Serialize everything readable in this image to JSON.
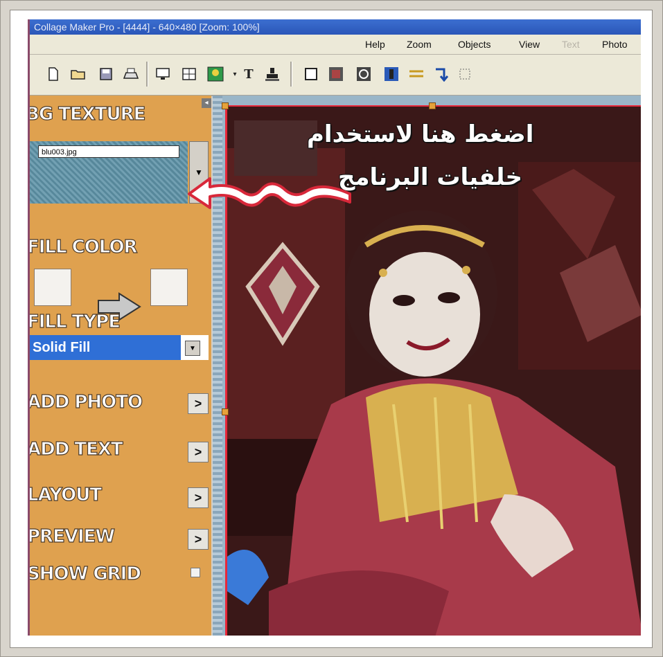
{
  "window": {
    "title": "Collage Maker Pro - [4444] - 640×480 [Zoom: 100%]"
  },
  "menu": {
    "items": [
      "Help",
      "Zoom",
      "Objects",
      "View",
      "Text",
      "Photo"
    ],
    "disabled": [
      "Text"
    ]
  },
  "toolbar": {
    "icons": [
      "new-icon",
      "open-icon",
      "save-icon",
      "print-icon",
      "monitor-icon",
      "layout-icon",
      "image-icon",
      "dropdown-icon",
      "text-icon",
      "stamp-icon",
      "frame-icon",
      "photo-frame-icon",
      "rotate-icon",
      "blue-photo-icon",
      "lines-icon",
      "arrow-curve-icon",
      "select-rect-icon"
    ]
  },
  "panel": {
    "bg_texture_label": "BG TEXTURE",
    "bg_texture_value": "blu003.jpg",
    "fill_color_label": "FILL COLOR",
    "fill_type_label": "FILL TYPE",
    "fill_type_value": "Solid Fill",
    "add_photo_label": "ADD PHOTO",
    "add_text_label": "ADD TEXT",
    "layout_label": "LAYOUT",
    "preview_label": "PREVIEW",
    "show_grid_label": "SHOW GRID",
    "go_glyph": ">"
  },
  "annotation": {
    "line1": "اضغط هنا لاستخدام",
    "line2": "خلفيات البرنامج",
    "arrow_color": "#d8283a"
  },
  "colors": {
    "panel_bg": "#dfa14f",
    "selection_blue": "#2f6fd6",
    "photo_border": "#e8283a"
  }
}
